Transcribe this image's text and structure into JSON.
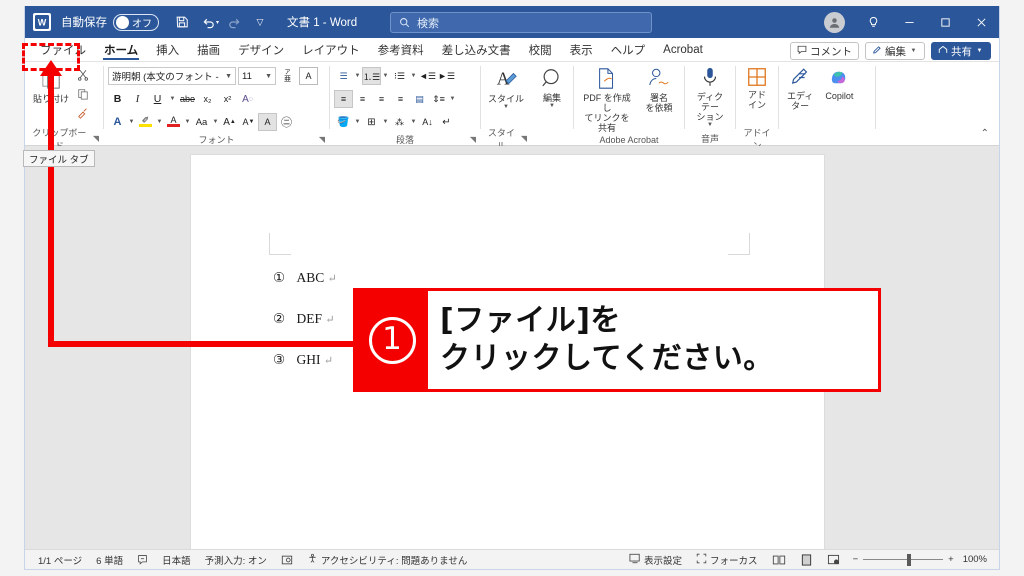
{
  "titlebar": {
    "app_icon": "word-logo-icon",
    "autosave_label": "自動保存",
    "autosave_state": "オフ",
    "save_icon": "save-icon",
    "undo_icon": "undo-icon",
    "redo_icon": "redo-icon",
    "customize_icon": "customize-quick-access-icon",
    "document_title": "文書 1  -  Word",
    "account_icon": "account-avatar-icon",
    "hint_icon": "lightbulb-icon",
    "minimize_icon": "minimize-icon",
    "maximize_icon": "maximize-icon",
    "close_icon": "close-icon"
  },
  "search": {
    "icon": "search-icon",
    "placeholder": "検索",
    "value": ""
  },
  "tabs": [
    {
      "label": "ファイル",
      "active": false
    },
    {
      "label": "ホーム",
      "active": true
    },
    {
      "label": "挿入",
      "active": false
    },
    {
      "label": "描画",
      "active": false
    },
    {
      "label": "デザイン",
      "active": false
    },
    {
      "label": "レイアウト",
      "active": false
    },
    {
      "label": "参考資料",
      "active": false
    },
    {
      "label": "差し込み文書",
      "active": false
    },
    {
      "label": "校閲",
      "active": false
    },
    {
      "label": "表示",
      "active": false
    },
    {
      "label": "ヘルプ",
      "active": false
    },
    {
      "label": "Acrobat",
      "active": false
    }
  ],
  "tabbar_right": {
    "comment_label": "コメント",
    "comment_icon": "comment-icon",
    "edit_label": "編集",
    "edit_icon": "pencil-icon",
    "share_label": "共有",
    "share_icon": "share-icon"
  },
  "ribbon": {
    "clipboard": {
      "group_label": "クリップボード",
      "paste_label": "貼り付け",
      "paste_icon": "paste-icon",
      "cut_icon": "scissors-icon",
      "copy_icon": "copy-icon",
      "format_painter_icon": "format-painter-icon",
      "dialog_icon": "dialog-launcher-icon"
    },
    "font": {
      "group_label": "フォント",
      "font_name": "游明朝 (本文のフォント - 日本語)",
      "font_size": "11",
      "phonetic_icon": "phonetic-guide-icon",
      "char_border_icon": "character-border-icon",
      "bold": "B",
      "italic": "I",
      "underline": "U",
      "strikethrough_icon": "strikethrough-icon",
      "subscript": "x₂",
      "superscript": "x²",
      "clear_format_icon": "clear-formatting-icon",
      "text_effects_icon": "text-effects-icon",
      "highlight_icon": "text-highlight-icon",
      "font_color_icon": "font-color-icon",
      "change_case_label": "Aa",
      "grow_font_icon": "grow-font-icon",
      "shrink_font_icon": "shrink-font-icon",
      "char_shading_icon": "character-shading-icon",
      "enclose_char_icon": "enclose-character-icon",
      "dialog_icon": "dialog-launcher-icon"
    },
    "paragraph": {
      "group_label": "段落",
      "bullets_icon": "bullet-list-icon",
      "numbering_icon": "numbered-list-icon",
      "multilevel_icon": "multilevel-list-icon",
      "decrease_indent_icon": "decrease-indent-icon",
      "increase_indent_icon": "increase-indent-icon",
      "align_left_icon": "align-left-icon",
      "align_center_icon": "align-center-icon",
      "align_right_icon": "align-right-icon",
      "justify_icon": "justify-icon",
      "distribute_icon": "distribute-icon",
      "line_spacing_icon": "line-spacing-icon",
      "shading_icon": "shading-icon",
      "borders_icon": "borders-icon",
      "phonetic_icon": "phonetic-icon",
      "sort_icon": "sort-icon",
      "show_marks_icon": "show-paragraph-marks-icon",
      "dialog_icon": "dialog-launcher-icon"
    },
    "styles": {
      "group_label": "スタイル",
      "button_label": "スタイル",
      "icon": "styles-icon",
      "dialog_icon": "dialog-launcher-icon"
    },
    "editing": {
      "group_label": "",
      "button_label": "編集",
      "icon": "magnifier-icon"
    },
    "acrobat": {
      "group_label": "Adobe Acrobat",
      "create_pdf_label": "PDF を作成し\nてリンクを共有",
      "create_pdf_icon": "create-pdf-icon",
      "request_sign_label": "署名\nを依頼",
      "request_sign_icon": "request-signature-icon"
    },
    "voice": {
      "group_label": "音声",
      "dictate_label": "ディクテー\nション",
      "dictate_icon": "microphone-icon"
    },
    "addins": {
      "group_label": "アドイン",
      "button_label": "アド\nイン",
      "icon": "addins-grid-icon"
    },
    "editor": {
      "editor_label": "エディ\nター",
      "editor_icon": "editor-pen-icon",
      "copilot_label": "Copilot",
      "copilot_icon": "copilot-icon"
    },
    "collapse_icon": "collapse-ribbon-icon"
  },
  "document": {
    "lines": [
      {
        "marker": "①",
        "text": "ABC",
        "mark": "↵"
      },
      {
        "marker": "②",
        "text": "DEF",
        "mark": "↵"
      },
      {
        "marker": "③",
        "text": "GHI",
        "mark": "↵"
      }
    ]
  },
  "statusbar": {
    "page_info": "1/1 ページ",
    "word_count": "6 単語",
    "proofing_icon": "proofing-icon",
    "language": "日本語",
    "prediction": "予測入力: オン",
    "track_icon": "track-changes-icon",
    "accessibility_icon": "accessibility-icon",
    "accessibility": "アクセシビリティ: 問題ありません",
    "display_settings_icon": "display-settings-icon",
    "display_settings": "表示設定",
    "focus_icon": "focus-icon",
    "focus": "フォーカス",
    "read_mode_icon": "read-mode-icon",
    "print_layout_icon": "print-layout-icon",
    "web_layout_icon": "web-layout-icon",
    "zoom_out_icon": "−",
    "zoom_in_icon": "+",
    "zoom_level": "100%"
  },
  "annotations": {
    "tooltip": "ファイル タブ",
    "callout_number": "①",
    "callout_line1": "[ファイル]を",
    "callout_line2": "クリックしてください。",
    "highlight_color": "#f40000"
  }
}
